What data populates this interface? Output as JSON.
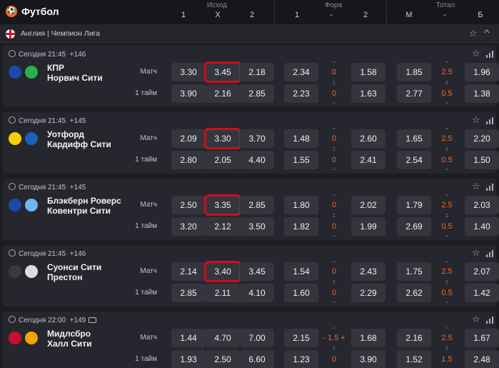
{
  "header": {
    "title": "Футбол",
    "groups": [
      {
        "name": "Исход",
        "cols": [
          "1",
          "X",
          "2"
        ]
      },
      {
        "name": "Фора",
        "cols": [
          "1",
          "-",
          "2"
        ]
      },
      {
        "name": "Тотал",
        "cols": [
          "М",
          "-",
          "Б"
        ]
      }
    ]
  },
  "league": {
    "name": "Англия | Чемпион Лига"
  },
  "matches": [
    {
      "time": "Сегодня 21:45",
      "markets": "+146",
      "tv": false,
      "team1": "КПР",
      "team2": "Норвич Сити",
      "rows": [
        {
          "label": "Матч",
          "o1": "3.30",
          "ox": "3.45",
          "o2": "2.18",
          "f1": "2.34",
          "fh": "0",
          "f2": "1.58",
          "tm": "1.85",
          "tl": "2.5",
          "tb": "1.96"
        },
        {
          "label": "1 тайм",
          "o1": "3.90",
          "ox": "2.16",
          "o2": "2.85",
          "f1": "2.23",
          "fh": "0",
          "f2": "1.63",
          "tm": "2.77",
          "tl": "0.5",
          "tb": "1.38"
        }
      ]
    },
    {
      "time": "Сегодня 21:45",
      "markets": "+145",
      "tv": false,
      "team1": "Уотфорд",
      "team2": "Кардифф Сити",
      "rows": [
        {
          "label": "Матч",
          "o1": "2.09",
          "ox": "3.30",
          "o2": "3.70",
          "f1": "1.48",
          "fh": "0",
          "f2": "2.60",
          "tm": "1.65",
          "tl": "2.5",
          "tb": "2.20"
        },
        {
          "label": "1 тайм",
          "o1": "2.80",
          "ox": "2.05",
          "o2": "4.40",
          "f1": "1.55",
          "fh": "0",
          "f2": "2.41",
          "tm": "2.54",
          "tl": "0.5",
          "tb": "1.50"
        }
      ]
    },
    {
      "time": "Сегодня 21:45",
      "markets": "+145",
      "tv": false,
      "team1": "Блэкберн Роверс",
      "team2": "Ковентри Сити",
      "rows": [
        {
          "label": "Матч",
          "o1": "2.50",
          "ox": "3.35",
          "o2": "2.85",
          "f1": "1.80",
          "fh": "0",
          "f2": "2.02",
          "tm": "1.79",
          "tl": "2.5",
          "tb": "2.03"
        },
        {
          "label": "1 тайм",
          "o1": "3.20",
          "ox": "2.12",
          "o2": "3.50",
          "f1": "1.82",
          "fh": "0",
          "f2": "1.99",
          "tm": "2.69",
          "tl": "0.5",
          "tb": "1.40"
        }
      ]
    },
    {
      "time": "Сегодня 21:45",
      "markets": "+146",
      "tv": false,
      "team1": "Суонси Сити",
      "team2": "Престон",
      "rows": [
        {
          "label": "Матч",
          "o1": "2.14",
          "ox": "3.40",
          "o2": "3.45",
          "f1": "1.54",
          "fh": "0",
          "f2": "2.43",
          "tm": "1.75",
          "tl": "2.5",
          "tb": "2.07"
        },
        {
          "label": "1 тайм",
          "o1": "2.85",
          "ox": "2.11",
          "o2": "4.10",
          "f1": "1.60",
          "fh": "0",
          "f2": "2.29",
          "tm": "2.62",
          "tl": "0.5",
          "tb": "1.42"
        }
      ]
    },
    {
      "time": "Сегодня 22:00",
      "markets": "+149",
      "tv": true,
      "team1": "Мидлсбро",
      "team2": "Халл Сити",
      "rows": [
        {
          "label": "Матч",
          "o1": "1.44",
          "ox": "4.70",
          "o2": "7.00",
          "f1": "2.15",
          "fh": "- 1.5 +",
          "f2": "1.68",
          "tm": "2.16",
          "tl": "2.5",
          "tb": "1.67"
        },
        {
          "label": "1 тайм",
          "o1": "1.93",
          "ox": "2.50",
          "o2": "6.60",
          "f1": "1.23",
          "fh": "0",
          "f2": "3.90",
          "tm": "1.52",
          "tl": "1.5",
          "tb": "2.48"
        }
      ]
    }
  ],
  "highlighted": "X odds (Матч row) outlined in red",
  "colors": {
    "accent": "#f26a21",
    "highlight": "#c8101e",
    "bg": "#1c1c22",
    "card": "#26262e",
    "odd": "#35353e"
  },
  "logos": [
    [
      "#1a4aa8",
      "#2bb04a"
    ],
    [
      "#f4d000",
      "#1f5fb5"
    ],
    [
      "#1a4aa8",
      "#6cb8f0"
    ],
    [
      "#3a3a3a",
      "#ddd"
    ],
    [
      "#c8102e",
      "#f5a300"
    ]
  ]
}
